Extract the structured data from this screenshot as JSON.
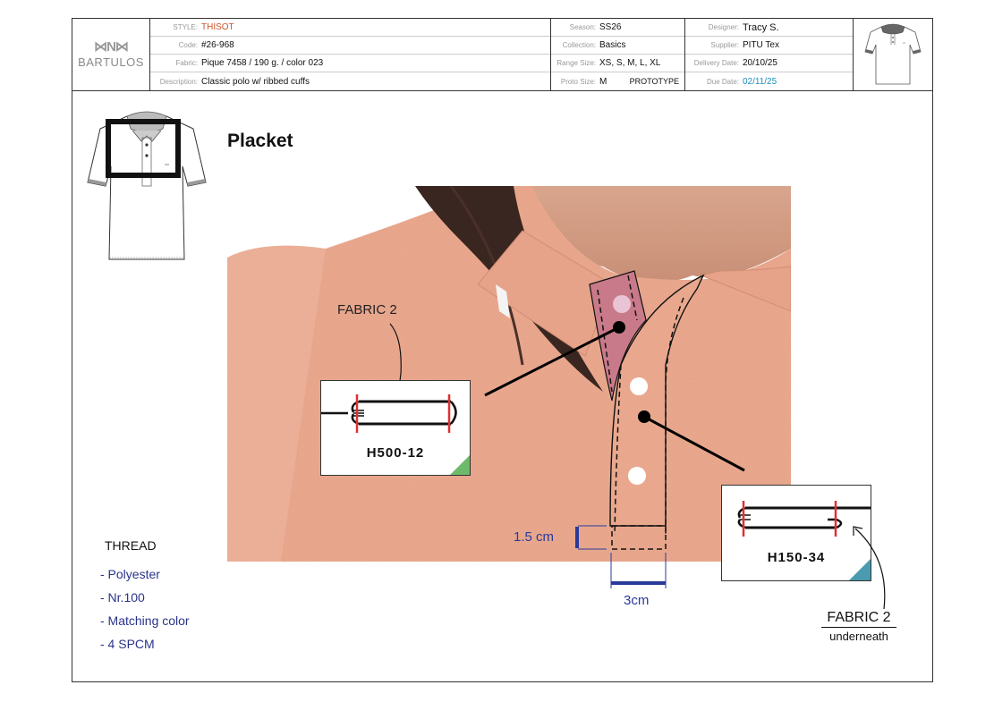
{
  "brand": {
    "mark": "⋈N⋈",
    "name": "BARTULOS"
  },
  "header": {
    "style": {
      "label": "STYLE:",
      "value": "THISOT"
    },
    "code": {
      "label": "Code:",
      "value": "#26-968"
    },
    "fabric": {
      "label": "Fabric:",
      "value": "Pique 7458 / 190 g. / color 023"
    },
    "description": {
      "label": "Description:",
      "value": "Classic polo w/ ribbed cuffs"
    },
    "season": {
      "label": "Season:",
      "value": "SS26"
    },
    "collection": {
      "label": "Collection:",
      "value": "Basics"
    },
    "range_size": {
      "label": "Range Size:",
      "value": "XS, S, M, L, XL"
    },
    "proto_size": {
      "label": "Proto Size:",
      "value": "M",
      "tag": "PROTOTYPE"
    },
    "designer": {
      "label": "Designer:",
      "value": "Tracy S."
    },
    "supplier": {
      "label": "Supplier:",
      "value": "PITU Tex"
    },
    "delivery_date": {
      "label": "Delivery Date:",
      "value": "20/10/25"
    },
    "due_date": {
      "label": "Due Date:",
      "value": "02/11/25"
    }
  },
  "page": {
    "title": "Placket"
  },
  "annotations": {
    "fabric2_left": "FABRIC 2",
    "callout_left": {
      "code": "H500-12",
      "corner_color": "#6dbb6a"
    },
    "callout_right": {
      "code": "H150-34",
      "corner_color": "#4a9bb0"
    },
    "fabric2_right": "FABRIC 2",
    "fabric2_right_sub": "underneath",
    "height_measure": "1.5 cm",
    "width_measure": "3cm"
  },
  "thread": {
    "title": "THREAD",
    "items": [
      "- Polyester",
      "- Nr.100",
      "- Matching color",
      "- 4 SPCM"
    ]
  },
  "colors": {
    "fabric": "#e9a88e",
    "placket_inner": "#c97a8a",
    "accent_red": "#e03030",
    "measure_blue": "#2a3a9a",
    "style_orange": "#d0542a",
    "due_blue": "#1f8fbf"
  }
}
